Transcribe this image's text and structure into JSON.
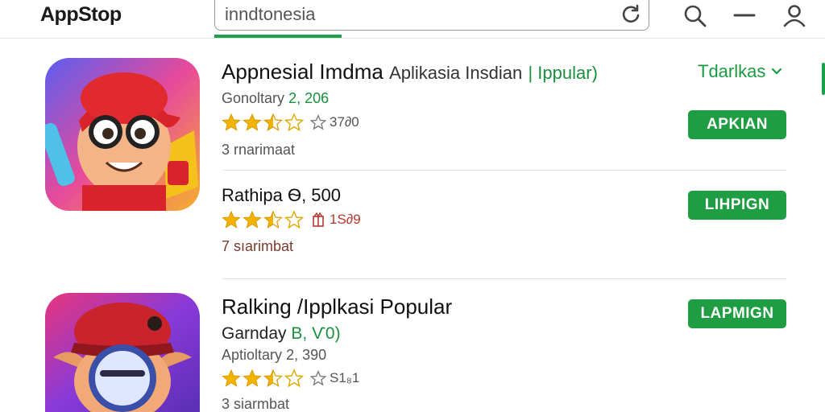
{
  "header": {
    "app_title": "AppStop",
    "search_value": "inndtonesia",
    "icons": [
      "refresh-icon",
      "search-icon",
      "minimize-icon",
      "profile-icon"
    ]
  },
  "sort": {
    "label": "Tdarlkas"
  },
  "colors": {
    "accent": "#1f9d43",
    "star": "#f2b400"
  },
  "apps": [
    {
      "title_main": "Appnesial Imdma",
      "title_sub": "Aplikasia Insdian",
      "title_accent": "| Ippular)",
      "meta1_label": "Gonoltary",
      "meta1_value": "2, 206",
      "stars": 2.5,
      "rating_count": "37∂0",
      "meta2": "3 rnarimaat",
      "button": "APKIAN"
    },
    {
      "title_main": "Rathipa",
      "title_value": "Ѳ, 500",
      "stars": 2.5,
      "rating_count": "1S∂9",
      "meta2": "7 sıarimbat",
      "button": "LIHPIGN"
    },
    {
      "title_main": "Ralking /Ipplkasi Popular",
      "meta0_label": "Garnday",
      "meta0_value": "B, Ѵ0)",
      "meta1_label": "Aptioltary",
      "meta1_value": "2, 390",
      "stars": 2.5,
      "rating_count": "S1₈1",
      "meta2": "3 siarmbat",
      "button": "LAPMIGN"
    }
  ]
}
